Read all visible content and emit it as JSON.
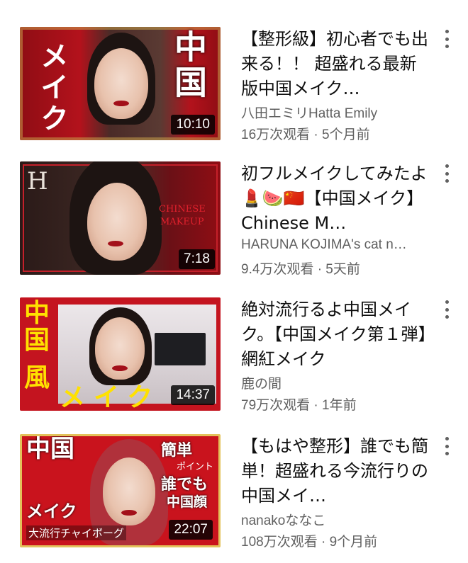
{
  "videos": [
    {
      "title": "【整形級】初心者でも出来る！！ 超盛れる最新版中国メイク…",
      "channel": "八田エミリHatta Emily",
      "stats": "16万次观看 · 5个月前",
      "duration": "10:10",
      "thumb_text": [
        "中国",
        "メイク"
      ]
    },
    {
      "title": "初フルメイクしてみたよ💄🍉🇨🇳【中国メイク】Chinese M…",
      "channel": "HARUNA KOJIMA's cat n…",
      "stats": "9.4万次观看 · 5天前",
      "duration": "7:18",
      "thumb_text": [
        "H",
        "CHINESE",
        "MAKEUP"
      ]
    },
    {
      "title": "絶対流行るよ中国メイク。【中国メイク第１弾】網紅メイク",
      "channel": "鹿の間",
      "stats": "79万次观看 · 1年前",
      "duration": "14:37",
      "thumb_text": [
        "中国",
        "風",
        "メイク"
      ]
    },
    {
      "title": "【もはや整形】誰でも簡単！超盛れる今流行りの中国メイ…",
      "channel": "nanakoななこ",
      "stats": "108万次观看 · 9个月前",
      "duration": "22:07",
      "thumb_text": [
        "中国",
        "メイク",
        "簡単",
        "ポイント",
        "誰でも",
        "中国顔",
        "大流行チャイボーグ"
      ]
    }
  ],
  "icons": {
    "menu": "more-vert-icon"
  },
  "colors": {
    "title": "#0f0f0f",
    "meta": "#606060",
    "thumb_red": "#b3121c"
  }
}
